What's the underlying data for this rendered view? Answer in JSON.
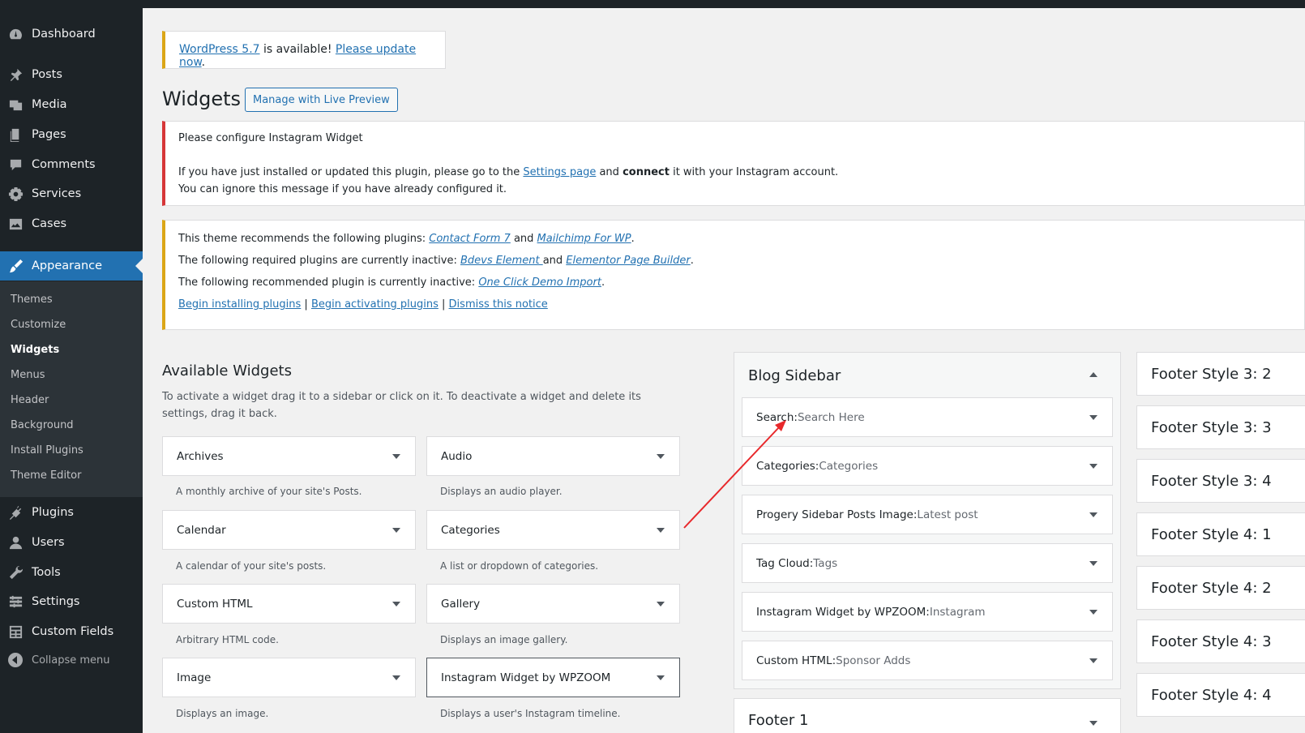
{
  "sidebar": {
    "items": [
      {
        "label": "Dashboard",
        "icon": "dashboard-icon"
      },
      {
        "label": "Posts",
        "icon": "pin-icon"
      },
      {
        "label": "Media",
        "icon": "media-icon"
      },
      {
        "label": "Pages",
        "icon": "pages-icon"
      },
      {
        "label": "Comments",
        "icon": "comment-icon"
      },
      {
        "label": "Services",
        "icon": "gear-icon"
      },
      {
        "label": "Cases",
        "icon": "image-icon"
      },
      {
        "label": "Appearance",
        "icon": "brush-icon"
      }
    ],
    "submenu": [
      "Themes",
      "Customize",
      "Widgets",
      "Menus",
      "Header",
      "Background",
      "Install Plugins",
      "Theme Editor"
    ],
    "bottom_items": [
      {
        "label": "Plugins",
        "icon": "plug-icon"
      },
      {
        "label": "Users",
        "icon": "user-icon"
      },
      {
        "label": "Tools",
        "icon": "wrench-icon"
      },
      {
        "label": "Settings",
        "icon": "settings-icon"
      },
      {
        "label": "Custom Fields",
        "icon": "fields-icon"
      }
    ],
    "collapse_label": "Collapse menu"
  },
  "update_notice": {
    "link1": "WordPress 5.7",
    "text": " is available! ",
    "link2": "Please update now",
    "end": "."
  },
  "page": {
    "title": "Widgets",
    "live_preview_button": "Manage with Live Preview"
  },
  "instagram_notice": {
    "title": "Please configure Instagram Widget",
    "line1_a": "If you have just installed or updated this plugin, please go to the ",
    "line1_link": "Settings page",
    "line1_b": " and ",
    "line1_bold": "connect",
    "line1_c": " it with your Instagram account.",
    "line2": "You can ignore this message if you have already configured it."
  },
  "plugin_notice": {
    "r1_text": "This theme recommends the following plugins: ",
    "r1_link1": "Contact Form 7",
    "r1_and": " and ",
    "r1_link2": "Mailchimp For WP",
    "r1_end": ".",
    "r2_text": "The following required plugins are currently inactive: ",
    "r2_link1": "Bdevs Element ",
    "r2_and": "and ",
    "r2_link2": "Elementor Page Builder",
    "r2_end": ".",
    "r3_text": "The following recommended plugin is currently inactive: ",
    "r3_link": "One Click Demo Import",
    "r3_end": ".",
    "action1": "Begin installing plugins",
    "sep": " | ",
    "action2": "Begin activating plugins",
    "action3": "Dismiss this notice"
  },
  "available": {
    "title": "Available Widgets",
    "desc": "To activate a widget drag it to a sidebar or click on it. To deactivate a widget and delete its settings, drag it back.",
    "widgets": [
      {
        "name": "Archives",
        "desc": "A monthly archive of your site's Posts."
      },
      {
        "name": "Audio",
        "desc": "Displays an audio player."
      },
      {
        "name": "Calendar",
        "desc": "A calendar of your site's posts."
      },
      {
        "name": "Categories",
        "desc": "A list or dropdown of categories."
      },
      {
        "name": "Custom HTML",
        "desc": "Arbitrary HTML code."
      },
      {
        "name": "Gallery",
        "desc": "Displays an image gallery."
      },
      {
        "name": "Image",
        "desc": "Displays an image."
      },
      {
        "name": "Instagram Widget by WPZOOM",
        "desc": "Displays a user's Instagram timeline."
      }
    ]
  },
  "blog_sidebar": {
    "title": "Blog Sidebar",
    "widgets": [
      {
        "name": "Search",
        "sep": ": ",
        "sub": "Search Here"
      },
      {
        "name": "Categories",
        "sep": ": ",
        "sub": "Categories"
      },
      {
        "name": "Progery Sidebar Posts Image",
        "sep": ": ",
        "sub": "Latest post"
      },
      {
        "name": "Tag Cloud",
        "sep": ": ",
        "sub": "Tags"
      },
      {
        "name": "Instagram Widget by WPZOOM",
        "sep": ": ",
        "sub": "Instagram"
      },
      {
        "name": "Custom HTML",
        "sep": ": ",
        "sub": "Sponsor Adds"
      }
    ]
  },
  "footer1": {
    "title": "Footer 1"
  },
  "footer_styles": [
    "Footer Style 3: 2",
    "Footer Style 3: 3",
    "Footer Style 3: 4",
    "Footer Style 4: 1",
    "Footer Style 4: 2",
    "Footer Style 4: 3",
    "Footer Style 4: 4"
  ],
  "colors": {
    "accent": "#2271b1",
    "sidebar_bg": "#1d2327",
    "error": "#d63638",
    "warning": "#dba617",
    "annotation_arrow": "#e8282b"
  }
}
